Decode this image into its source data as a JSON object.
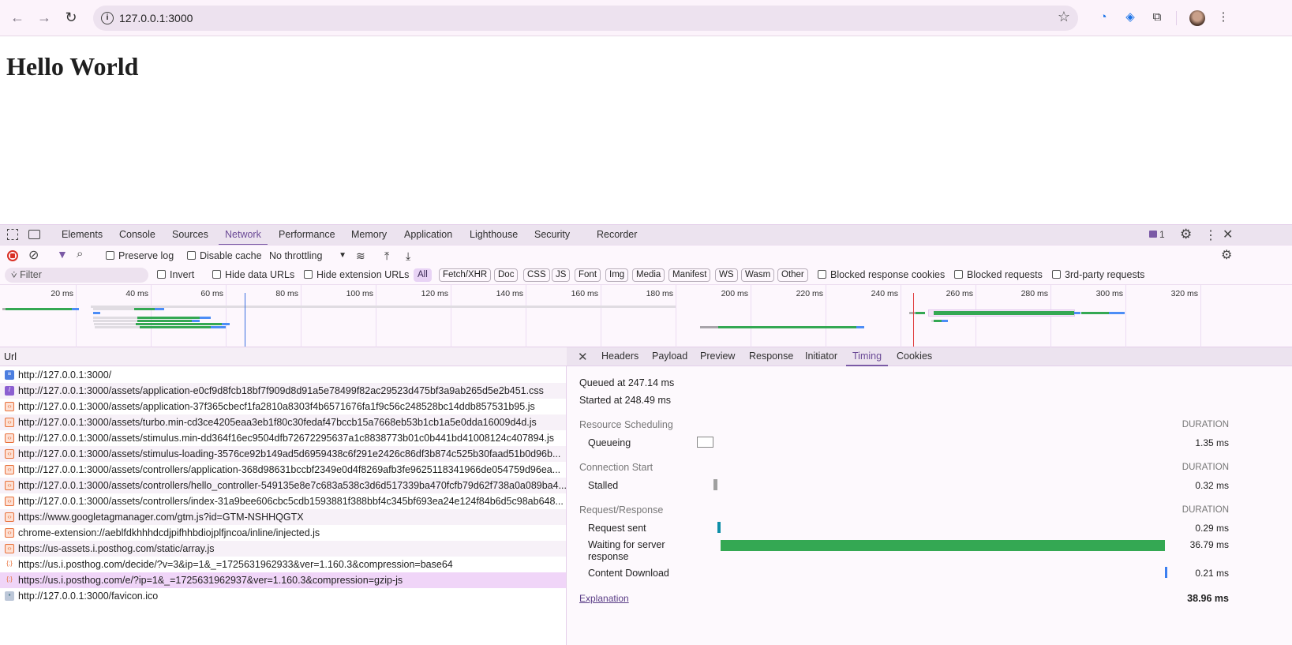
{
  "browser": {
    "url": "127.0.0.1:3000"
  },
  "page": {
    "heading": "Hello World"
  },
  "devtools": {
    "tabs": [
      "Elements",
      "Console",
      "Sources",
      "Network",
      "Performance",
      "Memory",
      "Application",
      "Lighthouse",
      "Security",
      "Recorder"
    ],
    "active_tab": "Network",
    "issues_count": "1",
    "toolbar": {
      "preserve_log": "Preserve log",
      "disable_cache": "Disable cache",
      "throttling": "No throttling"
    },
    "filter": {
      "placeholder": "Filter",
      "invert": "Invert",
      "hide_data_urls": "Hide data URLs",
      "hide_extension_urls": "Hide extension URLs",
      "types": [
        "All",
        "Fetch/XHR",
        "Doc",
        "CSS",
        "JS",
        "Font",
        "Img",
        "Media",
        "Manifest",
        "WS",
        "Wasm",
        "Other"
      ],
      "blocked_cookies": "Blocked response cookies",
      "blocked_requests": "Blocked requests",
      "third_party": "3rd-party requests"
    },
    "overview": {
      "ticks": [
        "20 ms",
        "40 ms",
        "60 ms",
        "80 ms",
        "100 ms",
        "120 ms",
        "140 ms",
        "160 ms",
        "180 ms",
        "200 ms",
        "220 ms",
        "240 ms",
        "260 ms",
        "280 ms",
        "300 ms",
        "320 ms"
      ],
      "markers": [
        {
          "ms": 65,
          "color": "#3b6fe0"
        },
        {
          "ms": 243.4,
          "color": "#e03b3b"
        }
      ],
      "bars": [
        {
          "lane": 1,
          "start": 24,
          "end": 180,
          "color": "#e0dce2"
        },
        {
          "lane": 2,
          "start": 0.4,
          "end": 1.3,
          "color": "#b0b0b0"
        },
        {
          "lane": 2,
          "start": 1.3,
          "end": 19,
          "color": "#34a853"
        },
        {
          "lane": 2,
          "start": 19,
          "end": 20.8,
          "color": "#4c8df6"
        },
        {
          "lane": 2,
          "start": 24.6,
          "end": 35.6,
          "color": "#e0dce2"
        },
        {
          "lane": 2,
          "start": 35.6,
          "end": 41,
          "color": "#34a853"
        },
        {
          "lane": 2,
          "start": 41,
          "end": 43.6,
          "color": "#4c8df6"
        },
        {
          "lane": 3,
          "start": 24.6,
          "end": 26.5,
          "color": "#4c8df6"
        },
        {
          "lane": 4,
          "start": 24.6,
          "end": 36.5,
          "color": "#e0dce2"
        },
        {
          "lane": 4,
          "start": 36.5,
          "end": 53,
          "color": "#34a853"
        },
        {
          "lane": 4,
          "start": 53,
          "end": 56,
          "color": "#4c8df6"
        },
        {
          "lane": 5,
          "start": 24.6,
          "end": 36.5,
          "color": "#e0dce2"
        },
        {
          "lane": 5,
          "start": 36.5,
          "end": 51,
          "color": "#34a853"
        },
        {
          "lane": 5,
          "start": 51,
          "end": 53,
          "color": "#4c8df6"
        },
        {
          "lane": 6,
          "start": 24.8,
          "end": 36,
          "color": "#e0dce2"
        },
        {
          "lane": 6,
          "start": 36,
          "end": 59,
          "color": "#34a853"
        },
        {
          "lane": 6,
          "start": 59,
          "end": 61,
          "color": "#4c8df6"
        },
        {
          "lane": 7,
          "start": 25,
          "end": 36.5,
          "color": "#e0dce2"
        },
        {
          "lane": 7,
          "start": 36.5,
          "end": 58,
          "color": "#34a853"
        },
        {
          "lane": 7,
          "start": 58,
          "end": 60,
          "color": "#4c8df6"
        },
        {
          "lane": 8,
          "start": 25,
          "end": 37,
          "color": "#e0dce2"
        },
        {
          "lane": 8,
          "start": 37,
          "end": 56,
          "color": "#34a853"
        },
        {
          "lane": 8,
          "start": 56,
          "end": 58,
          "color": "#4c8df6"
        },
        {
          "lane": 3,
          "start": 242.3,
          "end": 244,
          "color": "#b0b0b0"
        },
        {
          "lane": 3,
          "start": 244,
          "end": 246.5,
          "color": "#34a853"
        },
        {
          "lane": 3,
          "start": 248.8,
          "end": 286.3,
          "color": "#34a853",
          "thick": true
        },
        {
          "lane": 3,
          "start": 286.3,
          "end": 288,
          "color": "#4c8df6"
        },
        {
          "lane": 3,
          "start": 288.2,
          "end": 295.6,
          "color": "#34a853"
        },
        {
          "lane": 3,
          "start": 295.6,
          "end": 299.8,
          "color": "#4c8df6"
        },
        {
          "lane": 5,
          "start": 248.2,
          "end": 248.8,
          "color": "#e0dce2"
        },
        {
          "lane": 5,
          "start": 248.8,
          "end": 251,
          "color": "#34a853"
        },
        {
          "lane": 5,
          "start": 251,
          "end": 252.6,
          "color": "#4c8df6"
        },
        {
          "lane": 8,
          "start": 186.5,
          "end": 191.4,
          "color": "#a8a4aa"
        },
        {
          "lane": 8,
          "start": 191.4,
          "end": 228.2,
          "color": "#34a853"
        },
        {
          "lane": 8,
          "start": 228.2,
          "end": 230.3,
          "color": "#4c8df6"
        }
      ]
    },
    "requests": {
      "header": "Url",
      "rows": [
        {
          "url": "http://127.0.0.1:3000/",
          "type": "doc"
        },
        {
          "url": "http://127.0.0.1:3000/assets/application-e0cf9d8fcb18bf7f909d8d91a5e78499f82ac29523d475bf3a9ab265d5e2b451.css",
          "type": "css"
        },
        {
          "url": "http://127.0.0.1:3000/assets/application-37f365cbecf1fa2810a8303f4b6571676fa1f9c56c248528bc14ddb857531b95.js",
          "type": "js"
        },
        {
          "url": "http://127.0.0.1:3000/assets/turbo.min-cd3ce4205eaa3eb1f80c30fedaf47bccb15a7668eb53b1cb1a5e0dda16009d4d.js",
          "type": "js"
        },
        {
          "url": "http://127.0.0.1:3000/assets/stimulus.min-dd364f16ec9504dfb72672295637a1c8838773b01c0b441bd41008124c407894.js",
          "type": "js"
        },
        {
          "url": "http://127.0.0.1:3000/assets/stimulus-loading-3576ce92b149ad5d6959438c6f291e2426c86df3b874c525b30faad51b0d96b...",
          "type": "js"
        },
        {
          "url": "http://127.0.0.1:3000/assets/controllers/application-368d98631bccbf2349e0d4f8269afb3fe9625118341966de054759d96ea...",
          "type": "js"
        },
        {
          "url": "http://127.0.0.1:3000/assets/controllers/hello_controller-549135e8e7c683a538c3d6d517339ba470fcfb79d62f738a0a089ba4...",
          "type": "js"
        },
        {
          "url": "http://127.0.0.1:3000/assets/controllers/index-31a9bee606cbc5cdb1593881f388bbf4c345bf693ea24e124f84b6d5c98ab648...",
          "type": "js"
        },
        {
          "url": "https://www.googletagmanager.com/gtm.js?id=GTM-NSHHQGTX",
          "type": "js"
        },
        {
          "url": "chrome-extension://aeblfdkhhhdcdjpifhhbdiojplfjncoa/inline/injected.js",
          "type": "js"
        },
        {
          "url": "https://us-assets.i.posthog.com/static/array.js",
          "type": "js"
        },
        {
          "url": "https://us.i.posthog.com/decide/?v=3&ip=1&_=1725631962933&ver=1.160.3&compression=base64",
          "type": "fetch"
        },
        {
          "url": "https://us.i.posthog.com/e/?ip=1&_=1725631962937&ver=1.160.3&compression=gzip-js",
          "type": "fetch",
          "selected": true
        },
        {
          "url": "http://127.0.0.1:3000/favicon.ico",
          "type": "img"
        }
      ]
    },
    "detail": {
      "tabs": [
        "Headers",
        "Payload",
        "Preview",
        "Response",
        "Initiator",
        "Timing",
        "Cookies"
      ],
      "active_tab": "Timing",
      "queued": "Queued at 247.14 ms",
      "started": "Started at 248.49 ms",
      "duration_label": "DURATION",
      "sections": [
        {
          "title": "Resource Scheduling",
          "phases": [
            {
              "label": "Queueing",
              "value": "1.35 ms",
              "ms": 1.35,
              "style": "outline"
            }
          ]
        },
        {
          "title": "Connection Start",
          "phases": [
            {
              "label": "Stalled",
              "value": "0.32 ms",
              "ms": 0.32,
              "color": "#a0a0a0"
            }
          ]
        },
        {
          "title": "Request/Response",
          "phases": [
            {
              "label": "Request sent",
              "value": "0.29 ms",
              "ms": 0.29,
              "color": "#0f8fa8"
            },
            {
              "label": "Waiting for server response",
              "value": "36.79 ms",
              "ms": 36.79,
              "color": "#34a853"
            },
            {
              "label": "Content Download",
              "value": "0.21 ms",
              "ms": 0.21,
              "color": "#3b7ff0"
            }
          ]
        }
      ],
      "explanation": "Explanation",
      "total": "38.96 ms"
    }
  }
}
